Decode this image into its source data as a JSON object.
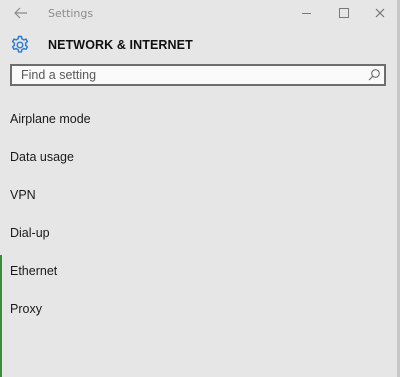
{
  "window": {
    "title": "Settings",
    "back_icon": "back-arrow-icon",
    "controls": [
      "minimize-icon",
      "maximize-icon",
      "close-icon"
    ]
  },
  "header": {
    "icon": "gear-icon",
    "title": "NETWORK & INTERNET"
  },
  "search": {
    "placeholder": "Find a setting",
    "value": "",
    "icon": "search-icon"
  },
  "menu": {
    "items": [
      {
        "label": "Airplane mode"
      },
      {
        "label": "Data usage"
      },
      {
        "label": "VPN"
      },
      {
        "label": "Dial-up"
      },
      {
        "label": "Ethernet"
      },
      {
        "label": "Proxy"
      }
    ]
  },
  "colors": {
    "background": "#e6e6e6",
    "accent": "#2b79d2",
    "text": "#1a1a1a"
  }
}
